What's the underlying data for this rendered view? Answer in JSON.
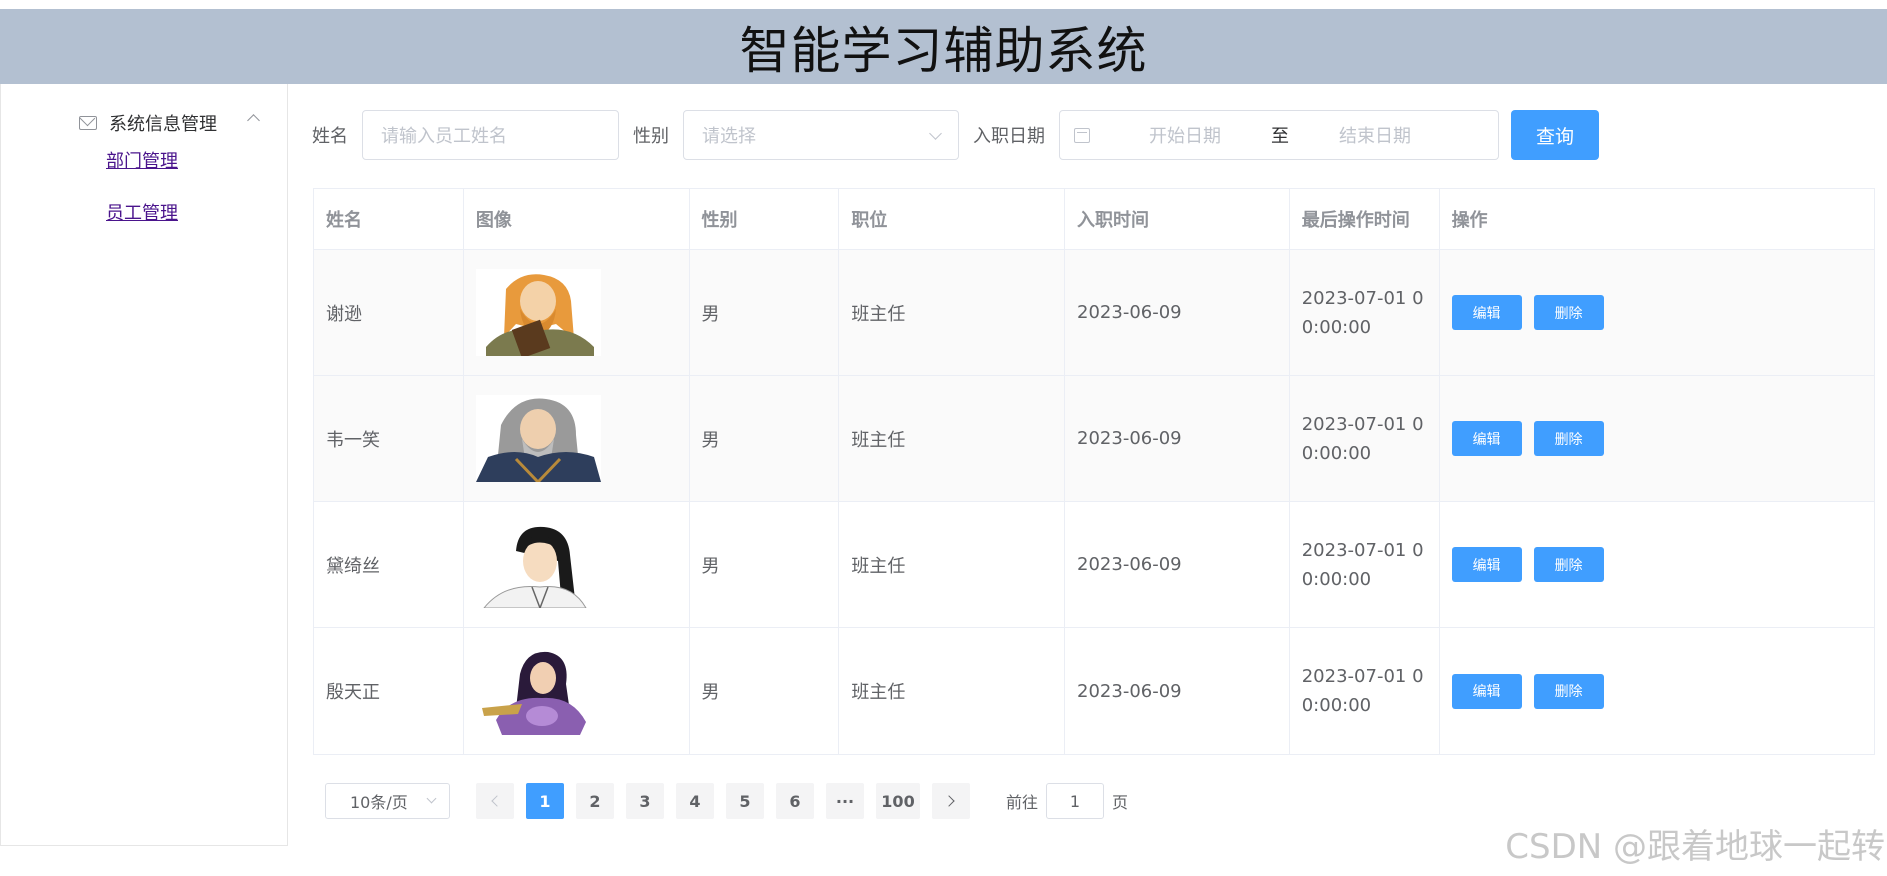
{
  "header": {
    "title": "智能学习辅助系统"
  },
  "sidebar": {
    "submenu_title": "系统信息管理",
    "items": [
      {
        "label": "部门管理"
      },
      {
        "label": "员工管理"
      }
    ]
  },
  "filter": {
    "name_label": "姓名",
    "name_placeholder": "请输入员工姓名",
    "gender_label": "性别",
    "gender_placeholder": "请选择",
    "date_label": "入职日期",
    "start_placeholder": "开始日期",
    "range_separator": "至",
    "end_placeholder": "结束日期",
    "query_label": "查询"
  },
  "table": {
    "columns": [
      "姓名",
      "图像",
      "性别",
      "职位",
      "入职时间",
      "最后操作时间",
      "操作"
    ],
    "rows": [
      {
        "name": "谢逊",
        "avatar": "avatar-bearded-man",
        "gender": "男",
        "position": "班主任",
        "entry_date": "2023-06-09",
        "update_time_1": "2023-07-01 0",
        "update_time_2": "0:00:00",
        "edit": "编辑",
        "delete": "删除"
      },
      {
        "name": "韦一笑",
        "avatar": "avatar-old-man",
        "gender": "男",
        "position": "班主任",
        "entry_date": "2023-06-09",
        "update_time_1": "2023-07-01 0",
        "update_time_2": "0:00:00",
        "edit": "编辑",
        "delete": "删除"
      },
      {
        "name": "黛绮丝",
        "avatar": "avatar-young-man",
        "gender": "男",
        "position": "班主任",
        "entry_date": "2023-06-09",
        "update_time_1": "2023-07-01 0",
        "update_time_2": "0:00:00",
        "edit": "编辑",
        "delete": "删除"
      },
      {
        "name": "殷天正",
        "avatar": "avatar-woman-purple",
        "gender": "男",
        "position": "班主任",
        "entry_date": "2023-06-09",
        "update_time_1": "2023-07-01 0",
        "update_time_2": "0:00:00",
        "edit": "编辑",
        "delete": "删除"
      }
    ]
  },
  "pagination": {
    "page_size": "10条/页",
    "pages": [
      "1",
      "2",
      "3",
      "4",
      "5",
      "6"
    ],
    "ellipsis": "···",
    "last_page": "100",
    "current_page": "1",
    "goto_prefix": "前往",
    "goto_value": "1",
    "goto_suffix": "页"
  },
  "colors": {
    "primary": "#409eff",
    "header_bg": "#b3c0d1",
    "link": "#4a148c"
  },
  "watermark": "CSDN @跟着地球一起转"
}
